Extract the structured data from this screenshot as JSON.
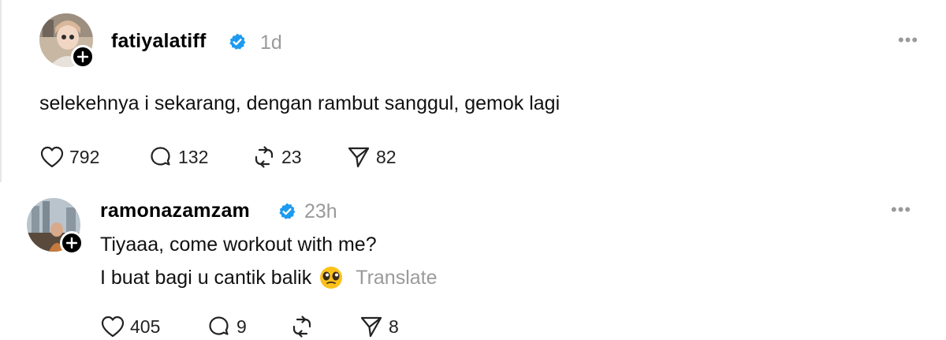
{
  "posts": [
    {
      "username": "fatiyalatiff",
      "time": "1d",
      "text": "selekehnya i sekarang, dengan rambut sanggul, gemok lagi",
      "likes": "792",
      "replies": "132",
      "reposts": "23",
      "shares": "82"
    },
    {
      "username": "ramonazamzam",
      "time": "23h",
      "text_line1": "Tiyaaa, come workout with me?",
      "text_line2": "I buat bagi u cantik balik",
      "translate": "Translate",
      "likes": "405",
      "replies": "9",
      "reposts": "",
      "shares": "8"
    }
  ],
  "colors": {
    "verified": "#1d9bf0",
    "muted": "#9a9a9a"
  },
  "icons": [
    "heart-icon",
    "comment-icon",
    "repost-icon",
    "send-icon",
    "more-icon",
    "verified-badge-icon",
    "follow-plus-icon",
    "pleading-emoji-icon"
  ]
}
